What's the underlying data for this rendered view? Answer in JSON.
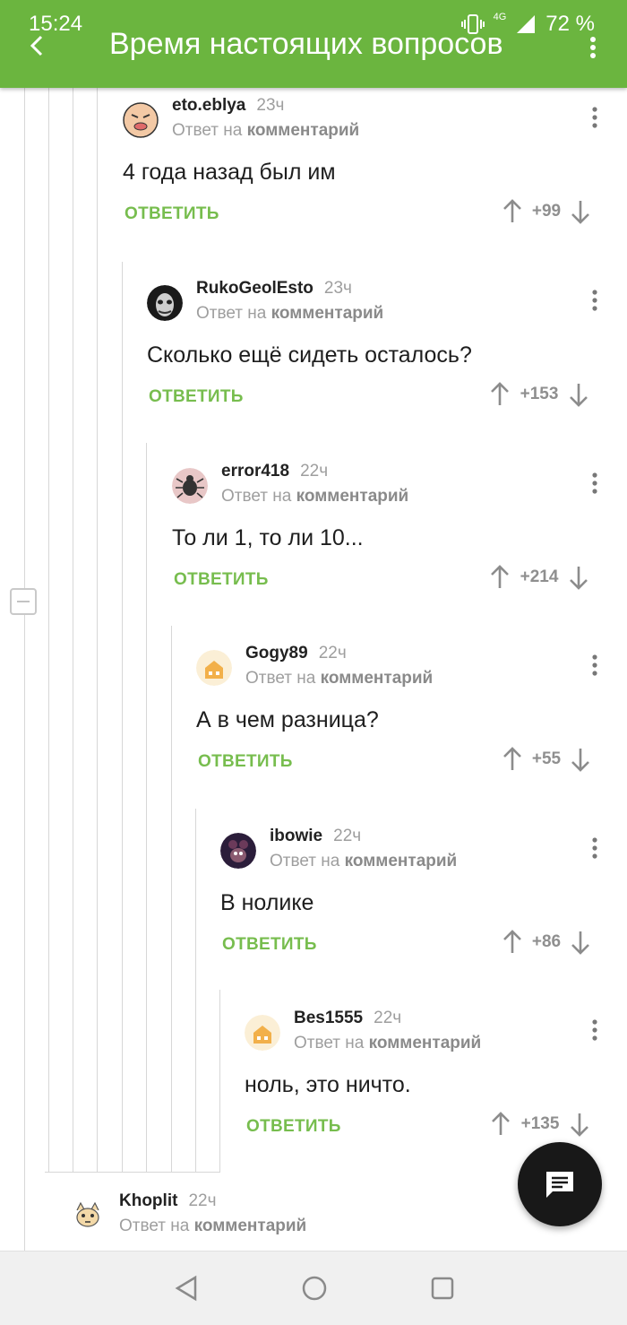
{
  "status_bar": {
    "time": "15:24",
    "network": "4G",
    "battery": "72 %"
  },
  "app_bar": {
    "title": "Время настоящих вопросов"
  },
  "reply_label": "ОТВЕТИТЬ",
  "comments": [
    {
      "author": "eto.eblya",
      "time": "23ч",
      "reply_prefix": "Ответ на",
      "reply_target": "комментарий",
      "text": "4 года назад был им",
      "rating": "+99"
    },
    {
      "author": "RukoGeolEsto",
      "time": "23ч",
      "reply_prefix": "Ответ на",
      "reply_target": "комментарий",
      "text": "Сколько ещё сидеть осталось?",
      "rating": "+153"
    },
    {
      "author": "error418",
      "time": "22ч",
      "reply_prefix": "Ответ на",
      "reply_target": "комментарий",
      "text": "То ли 1, то ли 10...",
      "rating": "+214"
    },
    {
      "author": "Gogy89",
      "time": "22ч",
      "reply_prefix": "Ответ на",
      "reply_target": "комментарий",
      "text": "А в чем разница?",
      "rating": "+55"
    },
    {
      "author": "ibowie",
      "time": "22ч",
      "reply_prefix": "Ответ на",
      "reply_target": "комментарий",
      "text": "В нолике",
      "rating": "+86"
    },
    {
      "author": "Bes1555",
      "time": "22ч",
      "reply_prefix": "Ответ на",
      "reply_target": "комментарий",
      "text": "ноль, это ничто.",
      "rating": "+135"
    },
    {
      "author": "Khoplit",
      "time": "22ч",
      "reply_prefix": "Ответ на",
      "reply_target": "комментарий"
    }
  ],
  "colors": {
    "accent": "#6bb53f",
    "reply": "#77bd4e",
    "muted": "#9e9e9e"
  },
  "icons": {
    "fab": "comment-icon",
    "nav": [
      "back-triangle-icon",
      "home-circle-icon",
      "recents-square-icon"
    ]
  }
}
